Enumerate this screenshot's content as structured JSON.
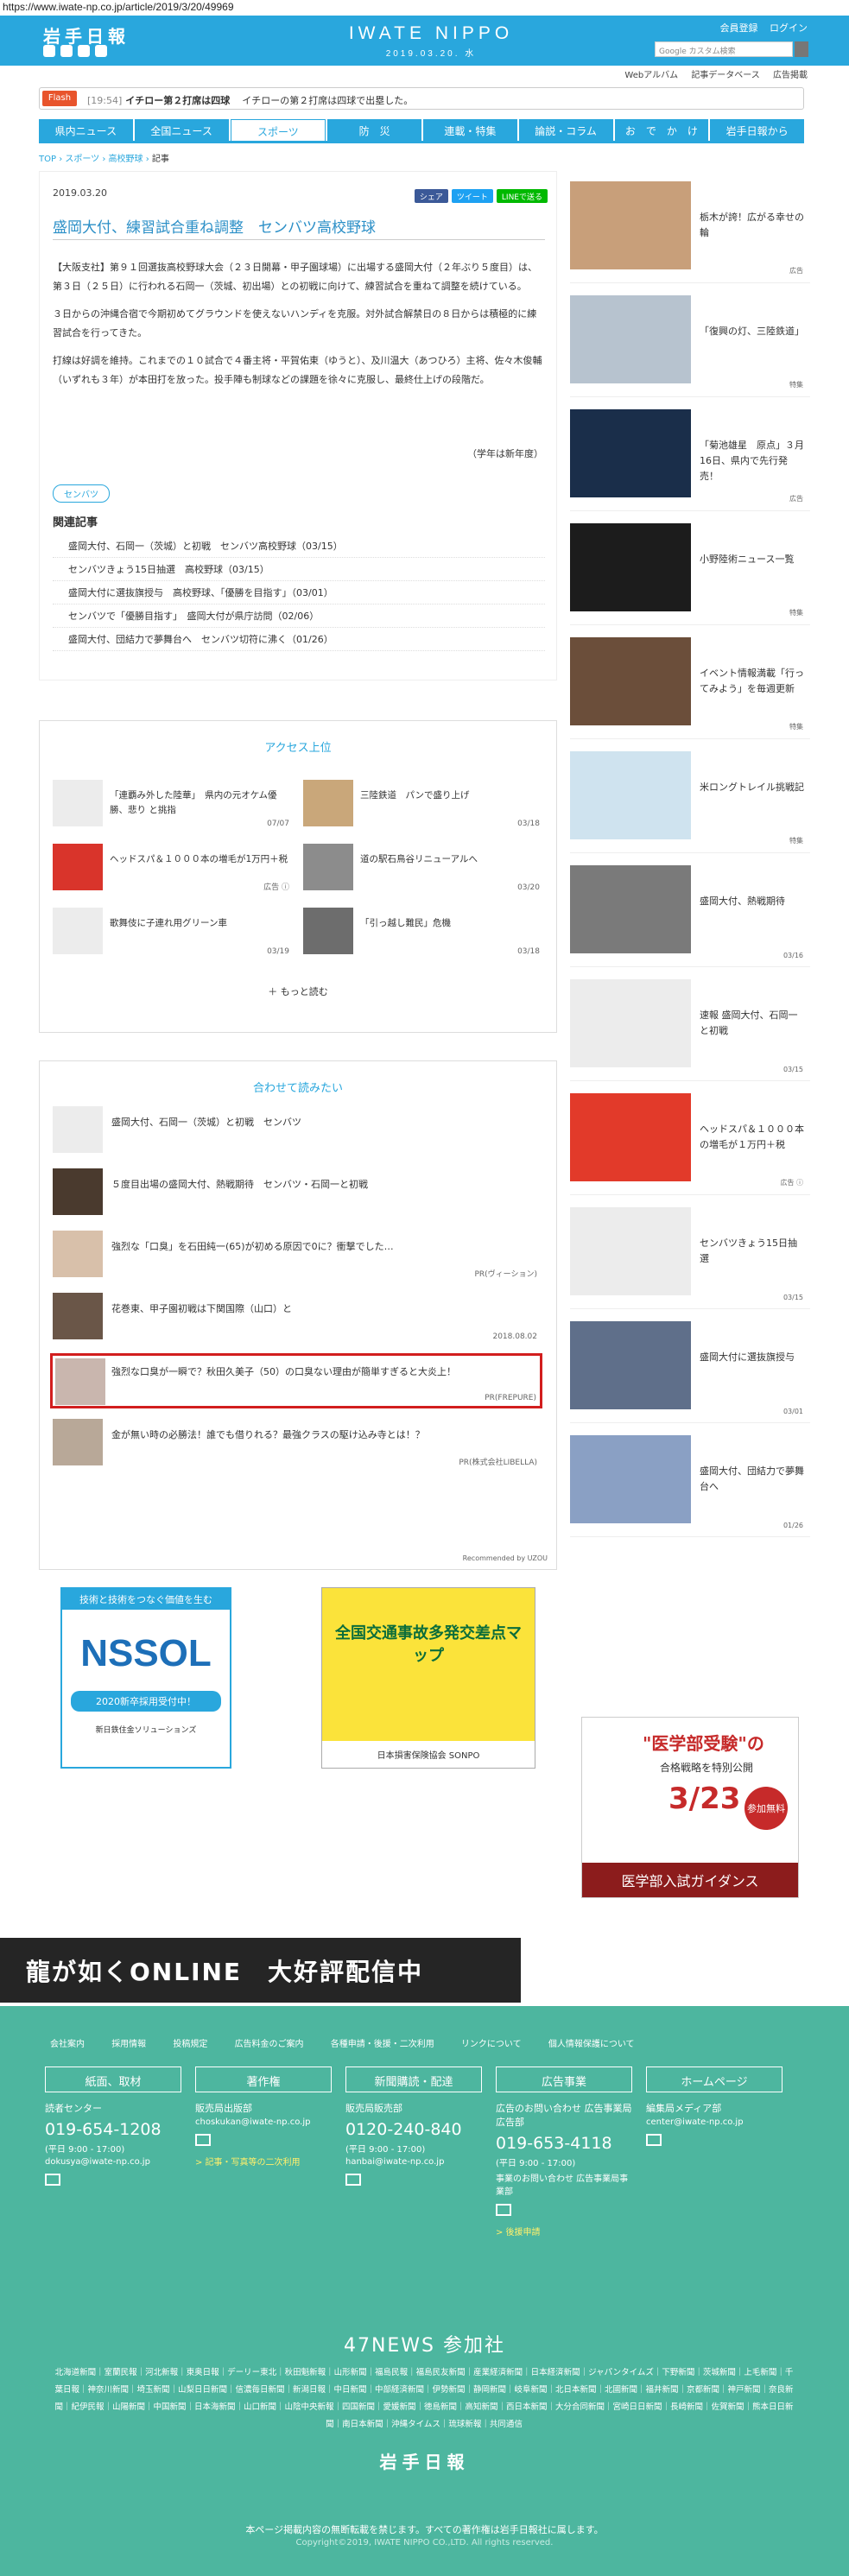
{
  "url": "https://www.iwate-np.co.jp/article/2019/3/20/49969",
  "header": {
    "logo": "岩手日報",
    "brand": "IWATE NIPPO",
    "date": "2019.03.20. 水",
    "links": [
      "会員登録",
      "ログイン"
    ],
    "search_placeholder": "Google カスタム検索"
  },
  "subnav": [
    "Webアルバム",
    "記事データベース",
    "広告掲載"
  ],
  "flash": {
    "tag": "Flash",
    "time": "[19:54]",
    "text": "イチロー第２打席は四球",
    "text2": "イチローの第２打席は四球で出塁した。"
  },
  "nav": [
    "県内ニュース",
    "全国ニュース",
    "スポーツ",
    "防　災",
    "連載・特集",
    "論説・コラム",
    "お　で　か　け",
    "岩手日報から"
  ],
  "breadcrumb": [
    "TOP",
    "スポーツ",
    "高校野球",
    "記事"
  ],
  "article": {
    "date": "2019.03.20",
    "title": "盛岡大付、練習試合重ね調整　センバツ高校野球",
    "share": [
      "シェア",
      "ツイート",
      "LINEで送る"
    ],
    "p1": "【大阪支社】第９１回選抜高校野球大会（２３日開幕・甲子園球場）に出場する盛岡大付（２年ぶり５度目）は、第３日（２５日）に行われる石岡一（茨城、初出場）との初戦に向けて、練習試合を重ねて調整を続けている。",
    "p2": "３日からの沖縄合宿で今期初めてグラウンドを使えないハンディを克服。対外試合解禁日の８日からは積極的に練習試合を行ってきた。",
    "p3": "打線は好調を維持。これまでの１０試合で４番主将・平賀佑東（ゆうと）、及川温大（あつひろ）主将、佐々木俊輔（いずれも３年）が本田打を放った。投手陣も制球などの課題を徐々に克服し、最終仕上げの段階だ。",
    "sign": "（学年は新年度）",
    "badge": "センバツ"
  },
  "related_title": "関連記事",
  "related": [
    "盛岡大付、石岡一（茨城）と初戦　センバツ高校野球（03/15）",
    "センバツきょう15日抽選　高校野球（03/15）",
    "盛岡大付に選抜旗授与　高校野球、「優勝を目指す」（03/01）",
    "センバツで「優勝目指す」　盛岡大付が県庁訪問（02/06）",
    "盛岡大付、団結力で夢舞台へ　センバツ切符に沸く（01/26）"
  ],
  "access": {
    "title": "アクセス上位",
    "items": [
      {
        "t": "「連覇み外した陸華」　県内の元オケム優勝、悲り と挑指",
        "d": "07/07"
      },
      {
        "t": "三陸鉄道　パンで盛り上げ",
        "d": "03/18"
      },
      {
        "t": "ヘッドスパ＆１０００本の増毛が1万円＋税",
        "d": "広告 ⓘ"
      },
      {
        "t": "道の駅石鳥谷リニューアルへ",
        "d": "03/20"
      },
      {
        "t": "歌舞伎に子連れ用グリーン車",
        "d": "03/19"
      },
      {
        "t": "「引っ越し難民」危機",
        "d": "03/18"
      }
    ],
    "more": "もっと読む"
  },
  "readmore": {
    "title": "合わせて読みたい",
    "items": [
      {
        "t": "盛岡大付、石岡一（茨城）と初戦　センバツ",
        "m": ""
      },
      {
        "t": "５度目出場の盛岡大付、熱戦期待　センバツ・石岡一と初戦",
        "m": ""
      },
      {
        "t": "強烈な「口臭」を石田純一(65)が初める原因で0に？衝撃でした…",
        "m": "PR(ヴィーション)"
      },
      {
        "t": "花巻東、甲子園初戦は下関国際（山口）と",
        "m": "2018.08.02"
      },
      {
        "t": "強烈な口臭が一瞬で？秋田久美子（50）の口臭ない理由が簡単すぎると大炎上！",
        "m": "PR(FREPURE)"
      },
      {
        "t": "金が無い時の必勝法！誰でも借りれる？最強クラスの駆け込み寺とは！？",
        "m": "PR(株式会社LIBELLA)"
      }
    ],
    "recommended": "Recommended by UZOU"
  },
  "ads": {
    "nssol": "NSSOL",
    "nssol_sub": "技術と技術をつなぐ価値を生む",
    "nssol_badge": "2020新卒採用受付中！",
    "nssol_co": "新日鉄住金ソリューションズ",
    "traffic": "全国交通事故多発交差点マップ",
    "traffic_co": "日本損害保険協会 SONPO",
    "med_title": "\"医学部受験\"の",
    "med_sub": "合格戦略を特別公開",
    "med_date": "3/23",
    "med_btn": "参加無料",
    "med_foot": "医学部入試ガイダンス",
    "game": "龍が如くONLINE　大好評配信中"
  },
  "side": [
    {
      "t": "栃木が誇！広がる幸せの輪",
      "m": "広告"
    },
    {
      "t": "「復興の灯、三陸鉄道」",
      "m": "特集"
    },
    {
      "t": "「菊池雄星　原点」３月16日、県内で先行発売！",
      "m": "広告"
    },
    {
      "t": "小野陸術ニュース一覧",
      "m": "特集"
    },
    {
      "t": "イベント情報満載「行ってみよう」を毎週更新",
      "m": "特集"
    },
    {
      "t": "米ロングトレイル挑戦記",
      "m": "特集"
    },
    {
      "t": "盛岡大付、熱戦期待",
      "m": "03/16"
    },
    {
      "t": "速報 盛岡大付、石岡一と初戦",
      "m": "03/15"
    },
    {
      "t": "ヘッドスパ＆１０００本の増毛が１万円＋税",
      "m": "広告 ⓘ"
    },
    {
      "t": "センバツきょう15日抽選",
      "m": "03/15"
    },
    {
      "t": "盛岡大付に選抜旗授与",
      "m": "03/01"
    },
    {
      "t": "盛岡大付、団結力で夢舞台へ",
      "m": "01/26"
    }
  ],
  "footer": {
    "links": [
      "会社案内",
      "採用情報",
      "投稿規定",
      "広告料金のご案内",
      "各種申請・後援・二次利用",
      "リンクについて",
      "個人情報保護について"
    ],
    "cols": [
      {
        "h": "紙面、取材",
        "s": "読者センター",
        "tel": "019-654-1208",
        "sm": "(平日 9:00 - 17:00)",
        "mail": "dokusya@iwate-np.co.jp"
      },
      {
        "h": "著作権",
        "s": "販売局出版部",
        "tel": "",
        "sm": "",
        "mail": "choskukan@iwate-np.co.jp",
        "yl": "> 記事・写真等の二次利用"
      },
      {
        "h": "新聞購読・配達",
        "s": "販売局販売部",
        "tel": "0120-240-840",
        "sm": "(平日 9:00 - 17:00)",
        "mail": "hanbai@iwate-np.co.jp"
      },
      {
        "h": "広告事業",
        "s": "広告のお問い合わせ 広告事業局広告部",
        "tel": "019-653-4118",
        "sm": "(平日 9:00 - 17:00)",
        "mail": "事業のお問い合わせ 広告事業局事業部",
        "yl": "> 後援申請"
      },
      {
        "h": "ホームページ",
        "s": "編集局メディア部",
        "tel": "",
        "sm": "",
        "mail": "center@iwate-np.co.jp"
      }
    ],
    "n47": "47NEWS 参加社",
    "n47list": "北海道新聞｜室蘭民報｜河北新報｜東奥日報｜デーリー東北｜秋田魁新報｜山形新聞｜福島民報｜福島民友新聞｜産業経済新聞｜日本経済新聞｜ジャパンタイムズ｜下野新聞｜茨城新聞｜上毛新聞｜千葉日報｜神奈川新聞｜埼玉新聞｜山梨日日新聞｜信濃毎日新聞｜新潟日報｜中日新聞｜中部経済新聞｜伊勢新聞｜静岡新聞｜岐阜新聞｜北日本新聞｜北國新聞｜福井新聞｜京都新聞｜神戸新聞｜奈良新聞｜紀伊民報｜山陽新聞｜中国新聞｜日本海新聞｜山口新聞｜山陰中央新報｜四国新聞｜愛媛新聞｜徳島新聞｜高知新聞｜西日本新聞｜大分合同新聞｜宮崎日日新聞｜長崎新聞｜佐賀新聞｜熊本日日新聞｜南日本新聞｜沖縄タイムス｜琉球新報｜共同通信",
    "logo": "岩手日報",
    "note": "本ページ掲載内容の無断転載を禁じます。すべての著作権は岩手日報社に属します。",
    "copy": "Copyright©2019, IWATE NIPPO CO.,LTD. All rights reserved."
  }
}
